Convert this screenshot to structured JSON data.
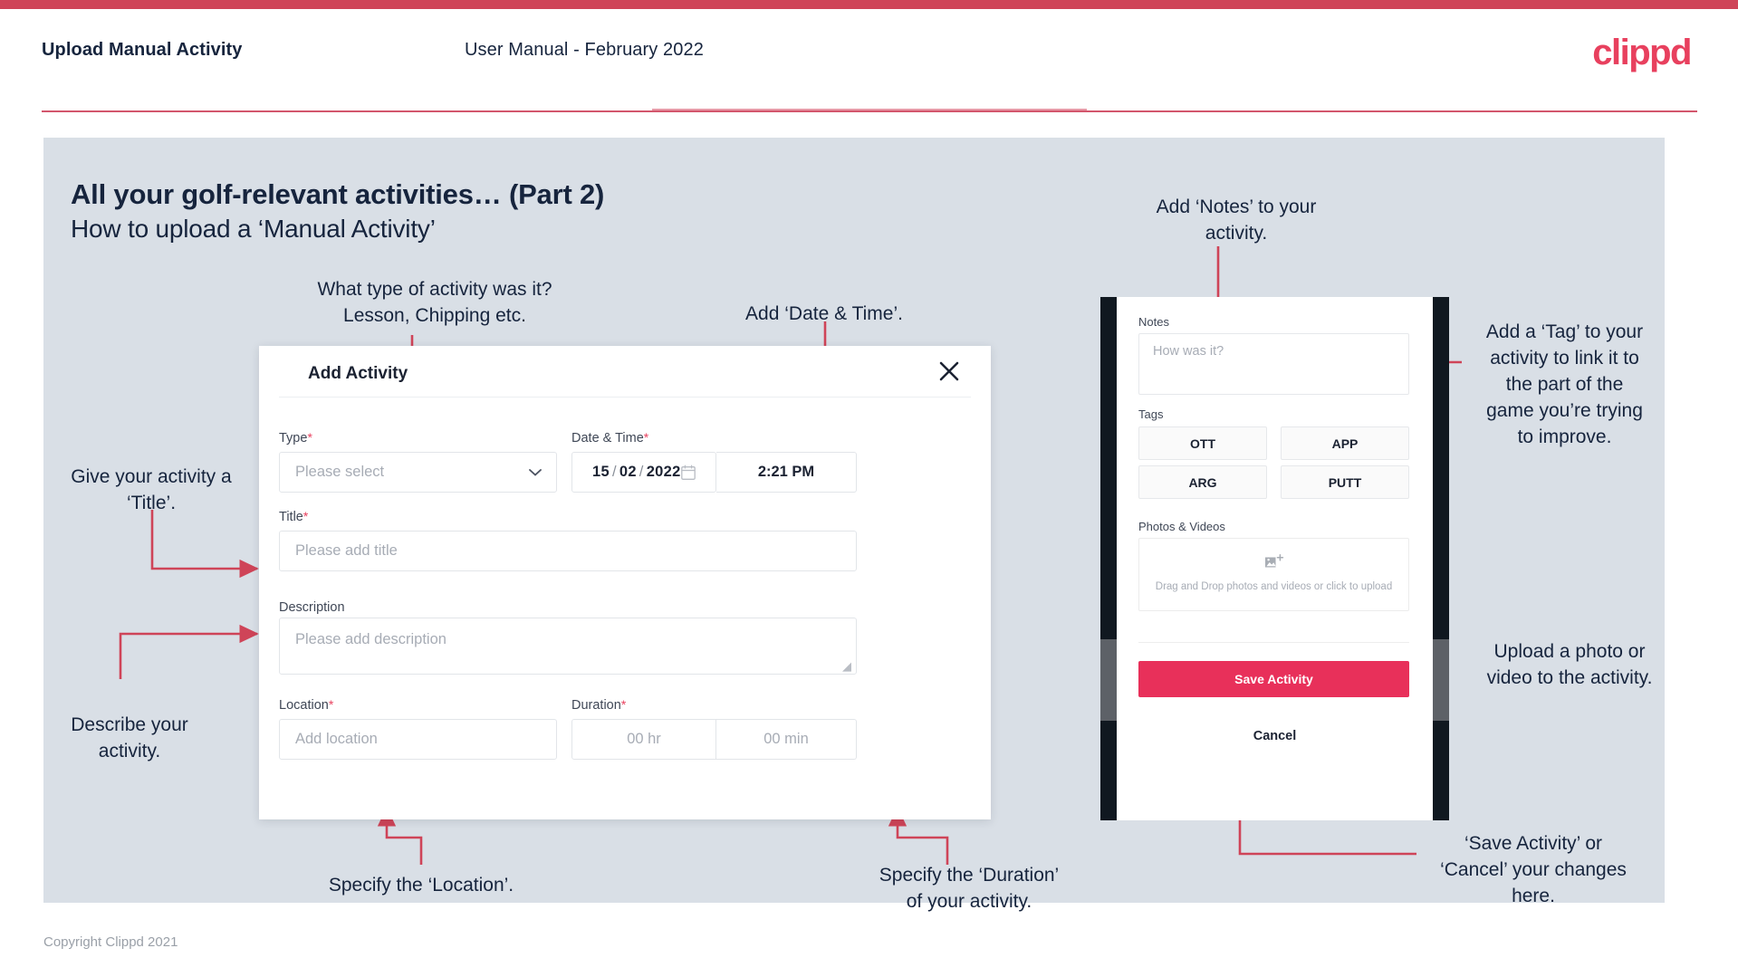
{
  "header": {
    "title": "Upload Manual Activity",
    "subtitle": "User Manual - February 2022",
    "logo": "clippd"
  },
  "slide": {
    "title": "All your golf-relevant activities… (Part 2)",
    "subtitle": "How to upload a ‘Manual Activity’"
  },
  "annotations": {
    "type": "What type of activity was it?\nLesson, Chipping etc.",
    "datetime": "Add ‘Date & Time’.",
    "title": "Give your activity a\n‘Title’.",
    "describe": "Describe your\nactivity.",
    "location": "Specify the ‘Location’.",
    "duration": "Specify the ‘Duration’\nof your activity.",
    "notes": "Add ‘Notes’ to your\nactivity.",
    "tags": "Add a ‘Tag’ to your\nactivity to link it to\nthe part of the\ngame you’re trying\nto improve.",
    "upload": "Upload a photo or\nvideo to the activity.",
    "save": "‘Save Activity’ or\n‘Cancel’ your changes\nhere."
  },
  "modal": {
    "title": "Add Activity",
    "close_icon": "close-icon",
    "type": {
      "label": "Type",
      "required": "*",
      "placeholder": "Please select",
      "chevron_icon": "chevron-down-icon"
    },
    "datetime": {
      "label": "Date & Time",
      "required": "*",
      "day": "15",
      "month": "02",
      "year": "2022",
      "separator": "/",
      "calendar_icon": "calendar-icon",
      "time": "2:21 PM"
    },
    "title_field": {
      "label": "Title",
      "required": "*",
      "placeholder": "Please add title"
    },
    "description": {
      "label": "Description",
      "placeholder": "Please add description"
    },
    "location": {
      "label": "Location",
      "required": "*",
      "placeholder": "Add location"
    },
    "duration": {
      "label": "Duration",
      "required": "*",
      "hours_placeholder": "00 hr",
      "minutes_placeholder": "00 min"
    }
  },
  "phone": {
    "notes": {
      "label": "Notes",
      "placeholder": "How was it?"
    },
    "tags": {
      "label": "Tags",
      "items": [
        "OTT",
        "APP",
        "ARG",
        "PUTT"
      ]
    },
    "photos": {
      "label": "Photos & Videos",
      "icon": "add-image-icon",
      "dropzone_text": "Drag and Drop photos and videos or click to upload"
    },
    "save_label": "Save Activity",
    "cancel_label": "Cancel"
  },
  "footer": {
    "copyright": "Copyright Clippd 2021"
  },
  "colors": {
    "brand_pink": "#e8405e",
    "save_pink": "#e8305a",
    "annotation_line": "#cf4458",
    "slide_bg": "#d9dfe6",
    "text_dark": "#16243d"
  }
}
